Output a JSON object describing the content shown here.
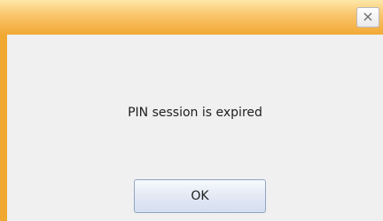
{
  "dialog": {
    "close_glyph": "×",
    "message": "PIN session is expired",
    "ok_label": "OK"
  },
  "colors": {
    "frame": "#f0a830",
    "client_bg": "#f0f0f0",
    "button_border": "#8fa4c4"
  }
}
